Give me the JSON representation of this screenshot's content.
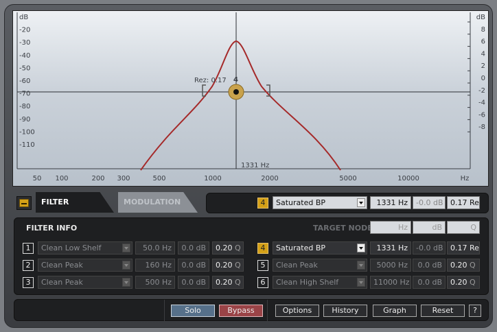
{
  "graph": {
    "db_left_labels": [
      "dB",
      "-20",
      "-30",
      "-40",
      "-50",
      "-60",
      "-70",
      "-80",
      "-90",
      "-100",
      "-110"
    ],
    "db_right_labels": [
      "dB",
      "8",
      "6",
      "4",
      "2",
      "0",
      "-2",
      "-4",
      "-6",
      "-8"
    ],
    "freq_labels": [
      "50",
      "100",
      "200",
      "300",
      "500",
      "1000",
      "2000",
      "5000",
      "10000",
      "Hz"
    ],
    "node": {
      "number": "4",
      "rez_label": "Rez: 0.17",
      "freq_label": "1331 Hz"
    },
    "curve_color": "#a52a2a",
    "node_color": "#c9a24c"
  },
  "tabs": {
    "filter": "FILTER",
    "modulation": "MODULATION"
  },
  "target": {
    "number": "4",
    "type": "Saturated BP",
    "freq": "1331 Hz",
    "gain": "-0.0 dB",
    "q": "0.17 Rez"
  },
  "info": {
    "title": "FILTER INFO",
    "target_node_label": "TARGET NODE",
    "target_headers": [
      "Hz",
      "dB",
      "Q"
    ],
    "left_filters": [
      {
        "num": "1",
        "type": "Clean Low Shelf",
        "freq": "50.0 Hz",
        "gain": "0.0 dB",
        "q": "0.20",
        "q_unit": "Q"
      },
      {
        "num": "2",
        "type": "Clean Peak",
        "freq": "160 Hz",
        "gain": "0.0 dB",
        "q": "0.20",
        "q_unit": "Q"
      },
      {
        "num": "3",
        "type": "Clean Peak",
        "freq": "500 Hz",
        "gain": "0.0 dB",
        "q": "0.20",
        "q_unit": "Q"
      }
    ],
    "right_filters": [
      {
        "num": "4",
        "type": "Saturated BP",
        "freq": "1331 Hz",
        "gain": "-0.0 dB",
        "q": "0.17",
        "q_unit": "Rez"
      },
      {
        "num": "5",
        "type": "Clean Peak",
        "freq": "5000 Hz",
        "gain": "0.0 dB",
        "q": "0.20",
        "q_unit": "Q"
      },
      {
        "num": "6",
        "type": "Clean High Shelf",
        "freq": "11000 Hz",
        "gain": "0.0 dB",
        "q": "0.20",
        "q_unit": "Q"
      }
    ]
  },
  "buttons": {
    "solo": "Solo",
    "bypass": "Bypass",
    "options": "Options",
    "history": "History",
    "graph": "Graph",
    "reset": "Reset",
    "help": "?"
  }
}
